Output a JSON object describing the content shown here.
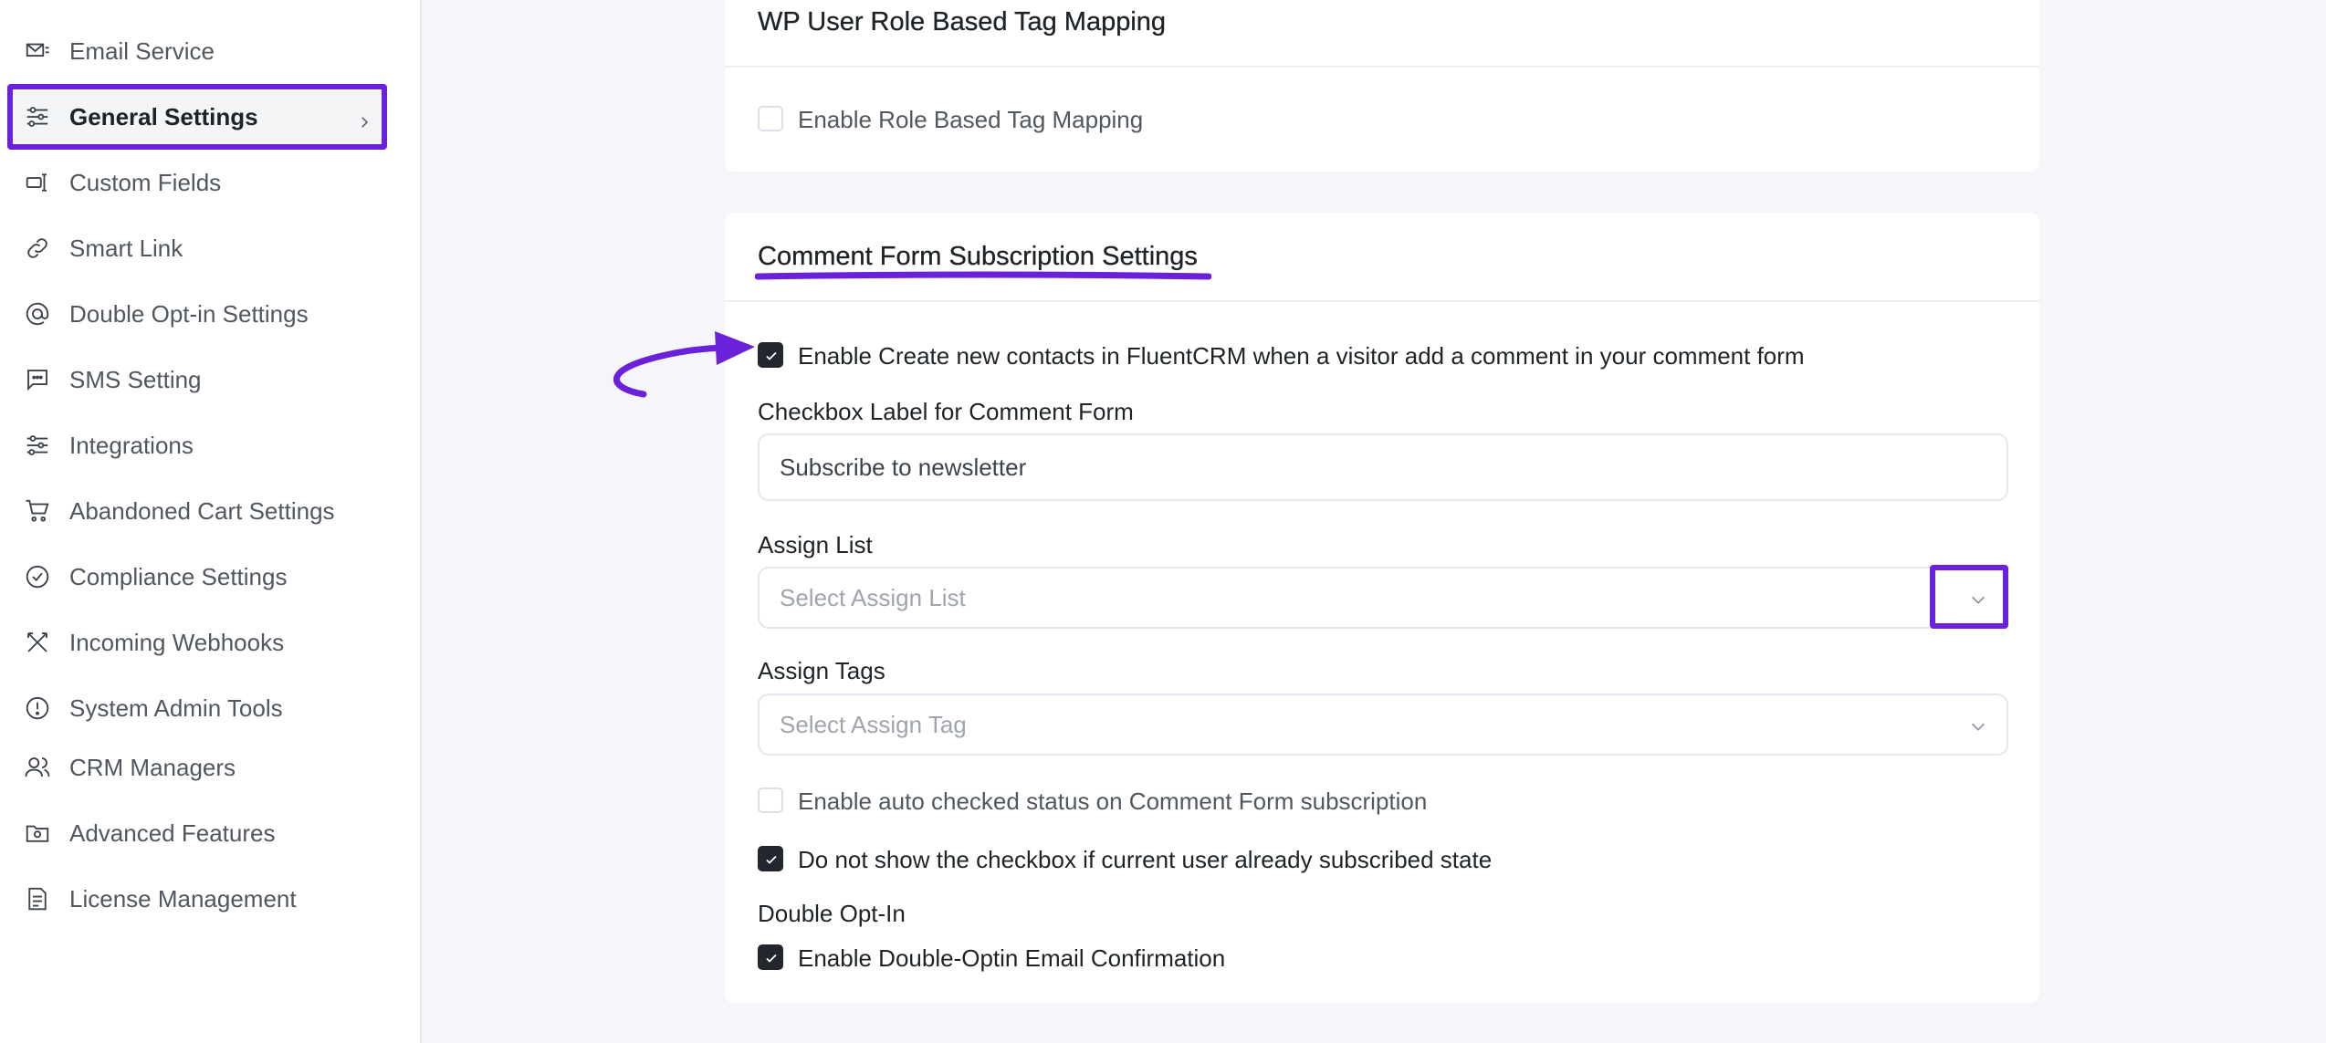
{
  "sidebar": {
    "items": [
      {
        "label": "Email Service",
        "icon": "envelope-icon"
      },
      {
        "label": "General Settings",
        "icon": "sliders-icon",
        "active": true
      },
      {
        "label": "Custom Fields",
        "icon": "field-icon"
      },
      {
        "label": "Smart Link",
        "icon": "link-icon"
      },
      {
        "label": "Double Opt-in Settings",
        "icon": "at-icon"
      },
      {
        "label": "SMS Setting",
        "icon": "message-icon"
      },
      {
        "label": "Integrations",
        "icon": "sliders-icon"
      },
      {
        "label": "Abandoned Cart Settings",
        "icon": "cart-icon"
      },
      {
        "label": "Compliance Settings",
        "icon": "check-circle-icon"
      },
      {
        "label": "Incoming Webhooks",
        "icon": "webhook-icon"
      },
      {
        "label": "System Admin Tools",
        "icon": "alert-circle-icon"
      },
      {
        "label": "CRM Managers",
        "icon": "users-icon"
      },
      {
        "label": "Advanced Features",
        "icon": "folder-gear-icon"
      },
      {
        "label": "License Management",
        "icon": "document-icon"
      }
    ]
  },
  "role_mapping": {
    "title": "WP User Role Based Tag Mapping",
    "enable_label": "Enable Role Based Tag Mapping",
    "enabled": false
  },
  "comment_form": {
    "title": "Comment Form Subscription Settings",
    "enable_label": "Enable Create new contacts in FluentCRM when a visitor add a comment in your comment form",
    "enabled": true,
    "checkbox_label_title": "Checkbox Label for Comment Form",
    "checkbox_label_value": "Subscribe to newsletter",
    "assign_list_title": "Assign List",
    "assign_list_placeholder": "Select Assign List",
    "assign_tags_title": "Assign Tags",
    "assign_tags_placeholder": "Select Assign Tag",
    "auto_checked_label": "Enable auto checked status on Comment Form subscription",
    "auto_checked": false,
    "hide_if_subscribed_label": "Do not show the checkbox if current user already subscribed state",
    "hide_if_subscribed": true,
    "double_optin_title": "Double Opt-In",
    "double_optin_label": "Enable Double-Optin Email Confirmation",
    "double_optin": true
  },
  "colors": {
    "annotation": "#6b21d9",
    "checkbox_checked": "#23262d"
  }
}
